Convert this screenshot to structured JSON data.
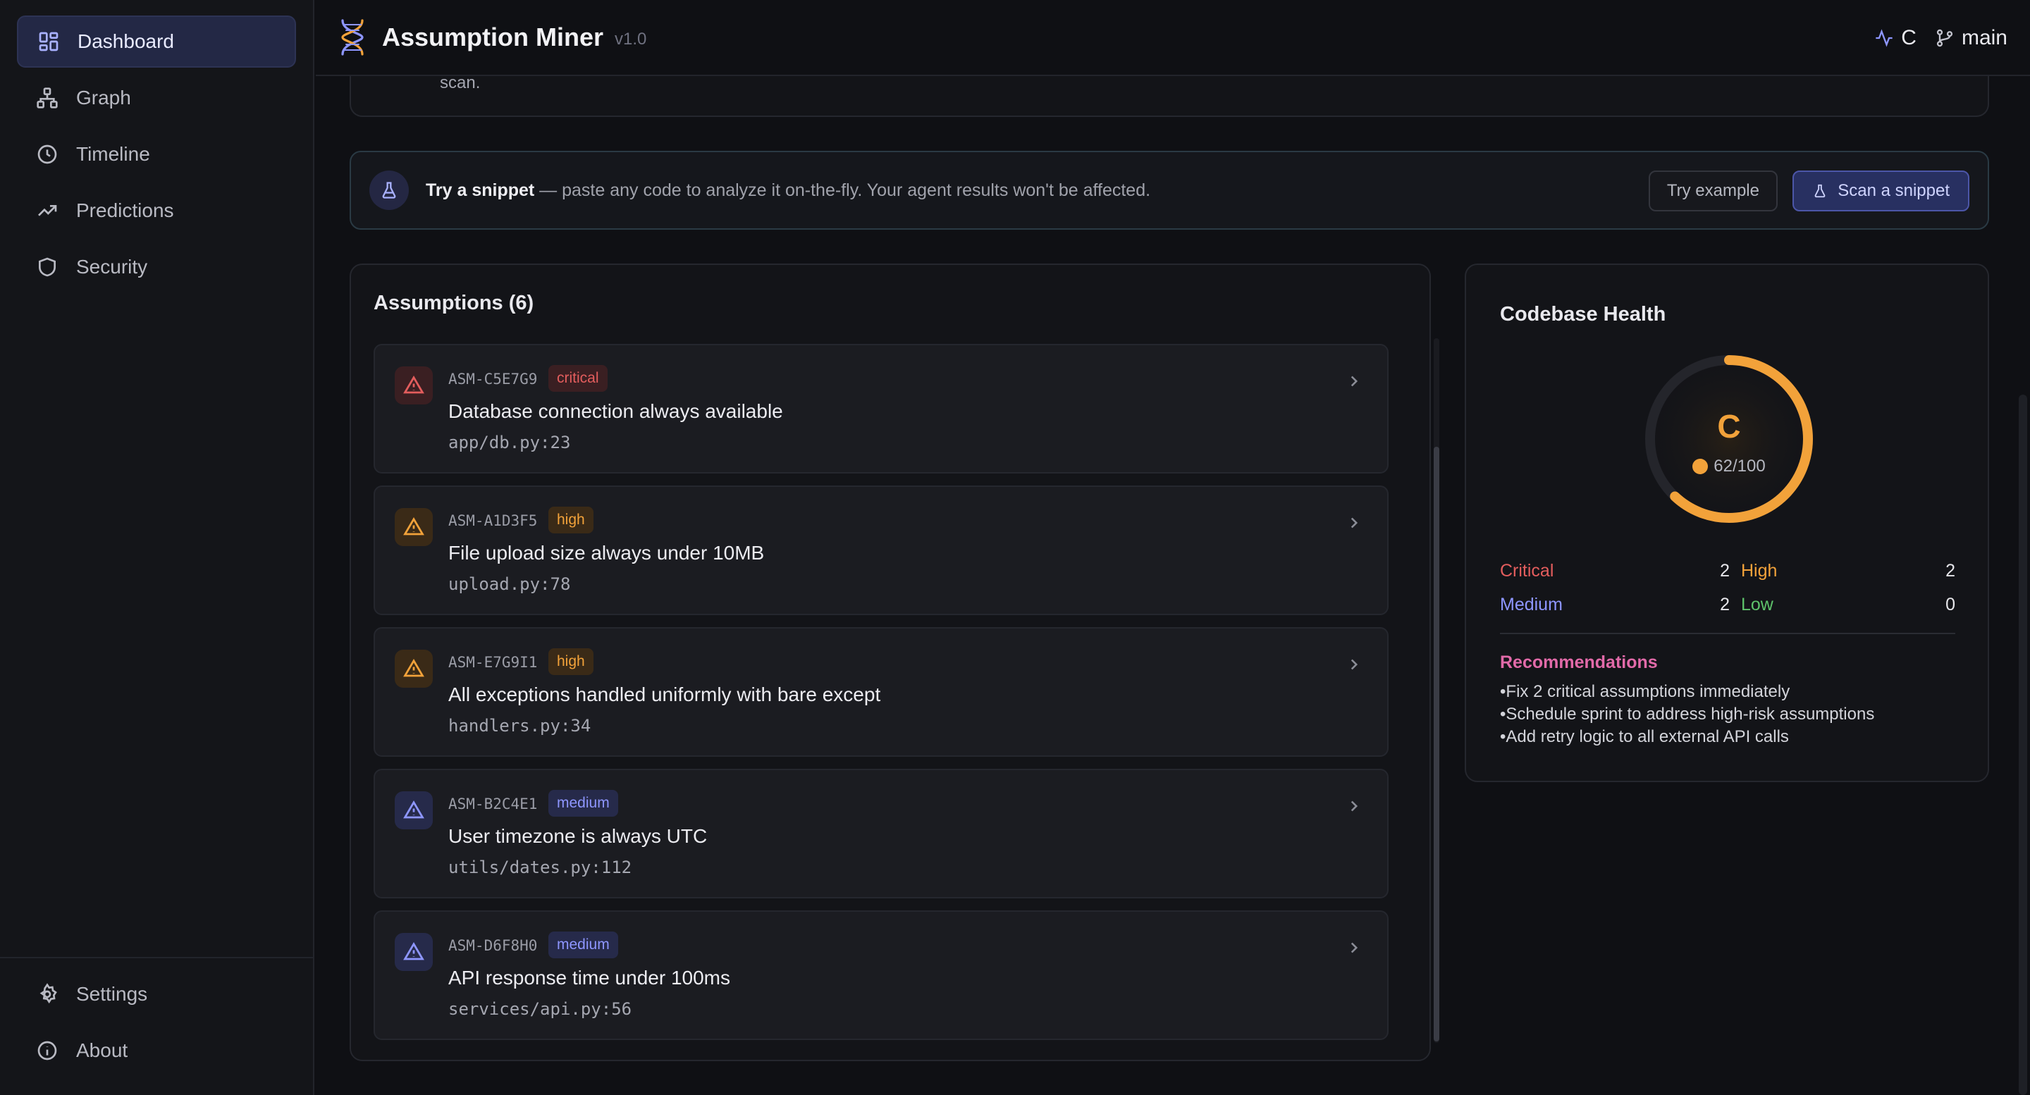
{
  "app": {
    "title": "Assumption Miner",
    "version": "v1.0"
  },
  "sidebar": {
    "items": [
      {
        "label": "Dashboard",
        "icon": "dashboard-icon",
        "active": true
      },
      {
        "label": "Graph",
        "icon": "graph-icon"
      },
      {
        "label": "Timeline",
        "icon": "clock-icon"
      },
      {
        "label": "Predictions",
        "icon": "trending-up-icon"
      },
      {
        "label": "Security",
        "icon": "shield-icon"
      }
    ],
    "bottom": [
      {
        "label": "Settings",
        "icon": "gear-icon"
      },
      {
        "label": "About",
        "icon": "info-icon"
      }
    ]
  },
  "topbar": {
    "grade": "C",
    "branch": "main"
  },
  "previous_card": {
    "text": "scan."
  },
  "snippet": {
    "title": "Try a snippet",
    "description": " — paste any code to analyze it on-the-fly. Your agent results won't be affected.",
    "try_example": "Try example",
    "scan_button": "Scan a snippet"
  },
  "assumptions": {
    "heading": "Assumptions (6)",
    "items": [
      {
        "id": "ASM-C5E7G9",
        "severity": "critical",
        "title": "Database connection always available",
        "file": "app/db.py:23"
      },
      {
        "id": "ASM-A1D3F5",
        "severity": "high",
        "title": "File upload size always under 10MB",
        "file": "upload.py:78"
      },
      {
        "id": "ASM-E7G9I1",
        "severity": "high",
        "title": "All exceptions handled uniformly with bare except",
        "file": "handlers.py:34"
      },
      {
        "id": "ASM-B2C4E1",
        "severity": "medium",
        "title": "User timezone is always UTC",
        "file": "utils/dates.py:112"
      },
      {
        "id": "ASM-D6F8H0",
        "severity": "medium",
        "title": "API response time under 100ms",
        "file": "services/api.py:56"
      }
    ]
  },
  "health": {
    "title": "Codebase Health",
    "grade": "C",
    "score": "62/100",
    "score_fraction": 0.62,
    "stats": [
      {
        "label": "Critical",
        "value": "2",
        "label2": "High",
        "value2": "2"
      },
      {
        "label": "Medium",
        "value": "2",
        "label2": "Low",
        "value2": "0"
      }
    ],
    "recommendations_title": "Recommendations",
    "recommendations": [
      "Fix 2 critical assumptions immediately",
      "Schedule sprint to address high-risk assumptions",
      "Add retry logic to all external API calls"
    ]
  },
  "colors": {
    "accent": "#8e96ff",
    "critical": "#e35d5d",
    "high": "#f2a23a",
    "medium": "#8e96ff",
    "low": "#5ec26a",
    "recommendations": "#e26aa9"
  }
}
